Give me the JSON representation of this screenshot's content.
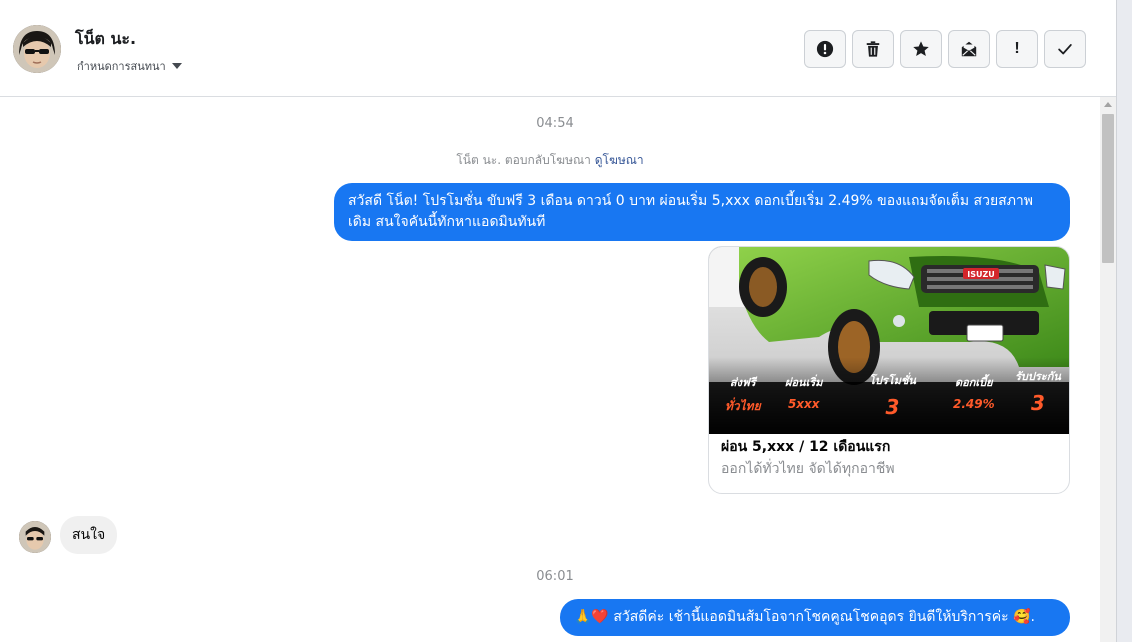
{
  "header": {
    "contact_name": "โน็ต นะ.",
    "assign_label": "กำหนดการสนทนา",
    "toolbar": [
      {
        "name": "report-button",
        "icon": "alert-circle-icon"
      },
      {
        "name": "delete-button",
        "icon": "trash-icon"
      },
      {
        "name": "star-button",
        "icon": "star-icon"
      },
      {
        "name": "mark-unread-button",
        "icon": "envelope-icon"
      },
      {
        "name": "important-button",
        "icon": "exclamation-icon",
        "text": "!"
      },
      {
        "name": "done-button",
        "icon": "check-icon"
      }
    ]
  },
  "thread": {
    "time_1": "04:54",
    "ad_reply_prefix": "โน็ต นะ. ตอบกลับโฆษณา",
    "ad_link": "ดูโฆษณา",
    "message_1": "สวัสดี โน็ต! โปรโมชั่น ขับฟรี 3 เดือน ดาวน์ 0 บาท ผ่อนเริ่ม 5,xxx  ดอกเบี้ยเริ่ม 2.49% ของแถมจัดเต็ม สวยสภาพเดิม สนใจคันนี้ทักหาแอดมินทันที",
    "card": {
      "title": "ผ่อน 5,xxx / 12 เดือนแรก",
      "subtitle": "ออกได้ทั่วไทย จัดได้ทุกอาชีพ",
      "image_brand": "ISUZU",
      "promos": [
        {
          "label": "ส่งฟรี",
          "value": "ทั่วไทย"
        },
        {
          "label": "ผ่อนเริ่ม",
          "value": "5xxx"
        },
        {
          "label": "โปรโมชั่น",
          "value": "3"
        },
        {
          "label": "ดอกเบี้ย",
          "value": "2.49%"
        },
        {
          "label": "รับประกัน",
          "value": "3"
        }
      ]
    },
    "incoming_1": "สนใจ",
    "time_2": "06:01",
    "message_2": "🙏❤️ สวัสดีค่ะ เช้านี้แอดมินส้มโอจากโชคคูณโชคอุดร ยินดีให้บริการค่ะ 🥰."
  },
  "colors": {
    "accent": "#1877f2",
    "incoming_bubble": "#f0f0f0",
    "promo_orange": "#ff5a2a",
    "car_green": "#5fb52c"
  }
}
